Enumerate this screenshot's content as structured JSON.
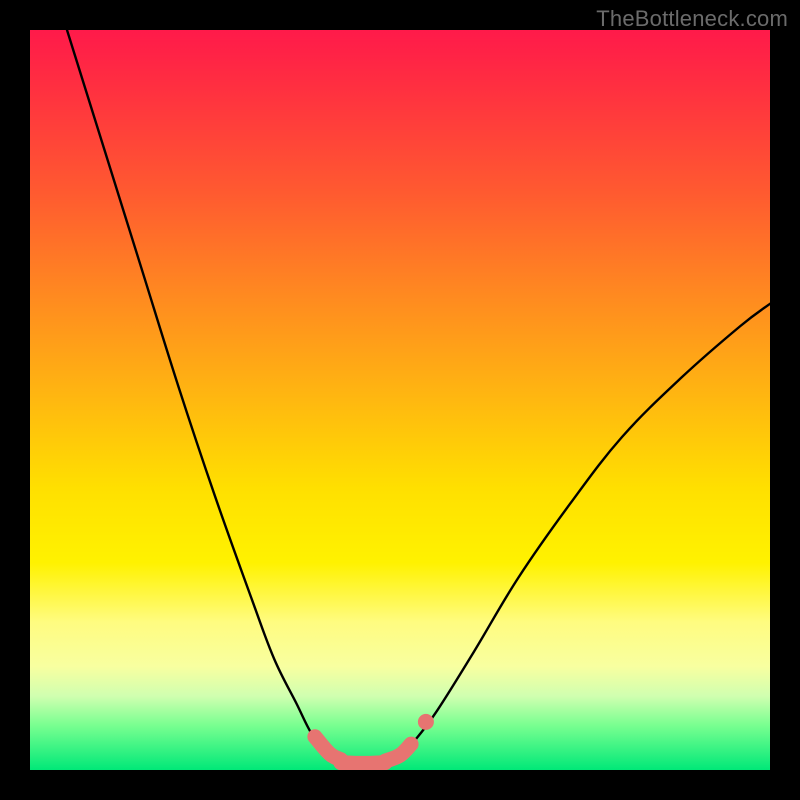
{
  "watermark": "TheBottleneck.com",
  "chart_data": {
    "type": "line",
    "title": "",
    "xlabel": "",
    "ylabel": "",
    "xlim": [
      0,
      100
    ],
    "ylim": [
      0,
      100
    ],
    "series": [
      {
        "name": "left-curve",
        "x": [
          5,
          10,
          15,
          20,
          25,
          30,
          33,
          36,
          38,
          40,
          41
        ],
        "y": [
          100,
          84,
          68,
          52,
          37,
          23,
          15,
          9,
          5,
          2.5,
          1.5
        ]
      },
      {
        "name": "right-curve",
        "x": [
          50,
          52,
          55,
          60,
          66,
          73,
          80,
          88,
          96,
          100
        ],
        "y": [
          2,
          4,
          8,
          16,
          26,
          36,
          45,
          53,
          60,
          63
        ]
      },
      {
        "name": "left-marker-segment",
        "x": [
          38.5,
          40.5,
          42
        ],
        "y": [
          4.5,
          2.2,
          1.4
        ]
      },
      {
        "name": "bottom-marker-segment",
        "x": [
          42,
          44,
          46,
          48
        ],
        "y": [
          1.0,
          0.9,
          0.9,
          1.0
        ]
      },
      {
        "name": "right-marker-segment",
        "x": [
          48,
          50,
          51.5
        ],
        "y": [
          1.2,
          2.0,
          3.5
        ]
      },
      {
        "name": "right-dot",
        "x": [
          53.5
        ],
        "y": [
          6.5
        ]
      }
    ],
    "marker_color": "#e77471",
    "curve_color": "#000000"
  }
}
